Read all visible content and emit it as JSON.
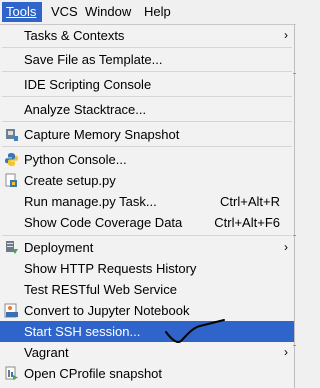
{
  "menubar": {
    "items": [
      {
        "label": "Tools",
        "mnemonic_index": 0
      },
      {
        "label": "VCS",
        "mnemonic_index": 2
      },
      {
        "label": "Window",
        "mnemonic_index": 0
      },
      {
        "label": "Help",
        "mnemonic_index": 0
      }
    ]
  },
  "menu": {
    "items": [
      {
        "label": "Tasks & Contexts",
        "submenu": "›"
      },
      {
        "label": "Save File as Template..."
      },
      {
        "label": "IDE Scripting Console"
      },
      {
        "label": "Analyze Stacktrace..."
      },
      {
        "label": "Capture Memory Snapshot",
        "icon": "memory-snapshot-icon"
      },
      {
        "label": "Python Console...",
        "icon": "python-icon"
      },
      {
        "label": "Create setup.py",
        "icon": "python-file-icon"
      },
      {
        "label": "Run manage.py Task...",
        "shortcut": "Ctrl+Alt+R"
      },
      {
        "label": "Show Code Coverage Data",
        "shortcut": "Ctrl+Alt+F6"
      },
      {
        "label": "Deployment",
        "icon": "deployment-icon",
        "submenu": "›"
      },
      {
        "label": "Show HTTP Requests History"
      },
      {
        "label": "Test RESTful Web Service"
      },
      {
        "label": "Convert to Jupyter Notebook",
        "icon": "jupyter-icon"
      },
      {
        "label": "Start SSH session...",
        "selected": true
      },
      {
        "label": "Vagrant",
        "submenu": "›"
      },
      {
        "label": "Open CProfile snapshot",
        "icon": "profile-icon"
      }
    ]
  },
  "colors": {
    "selection": "#2f65ca",
    "menu_background": "#f2f2f2",
    "annotation_stroke": "#000000"
  }
}
